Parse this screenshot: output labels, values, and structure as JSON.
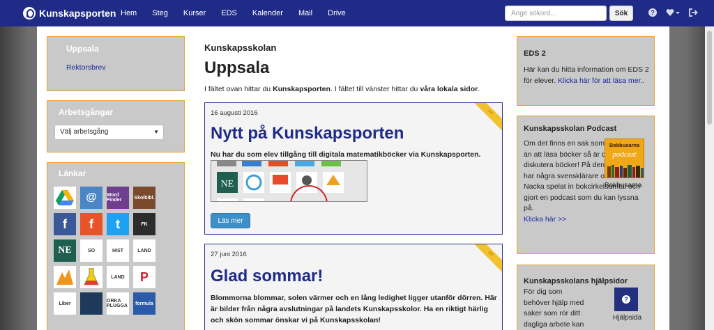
{
  "nav": {
    "brand": "Kunskapsporten",
    "links": [
      "Hem",
      "Steg",
      "Kurser",
      "EDS",
      "Kalender",
      "Mail",
      "Drive"
    ],
    "search_placeholder": "Ange sökord...",
    "search_button": "Sök",
    "icons": [
      "help-icon",
      "heart-dropdown-icon",
      "logout-icon"
    ]
  },
  "left": {
    "location_title": "Uppsala",
    "location_link": "Rektorsbrev",
    "pathways_title": "Arbetsgångar",
    "pathways_select": "Välj arbetsgång",
    "links_title": "Länkar",
    "tiles": [
      {
        "name": "google-drive-tile",
        "label": "",
        "bg": "#ffffff"
      },
      {
        "name": "mail-tile",
        "label": "@",
        "bg": "#4a86c5"
      },
      {
        "name": "wordfinder-tile",
        "label": "Word Finder",
        "bg": "#6f3f8e"
      },
      {
        "name": "skolbiblioteket-tile",
        "label": "Skolbibl.",
        "bg": "#7a4a2c"
      },
      {
        "name": "facebook-tile",
        "label": "f",
        "bg": "#3b5998"
      },
      {
        "name": "facebook-orange-tile",
        "label": "f",
        "bg": "#e8542a"
      },
      {
        "name": "twitter-tile",
        "label": "t",
        "bg": "#1da1f2"
      },
      {
        "name": "fk-tile",
        "label": "FK",
        "bg": "#2c2c2c"
      },
      {
        "name": "ne-tile",
        "label": "NE",
        "bg": "#1f5f4f"
      },
      {
        "name": "so-rummet-tile",
        "label": "SO",
        "bg": "#ffffff"
      },
      {
        "name": "historiska-bibliotek-tile",
        "label": "HIST",
        "bg": "#ffffff"
      },
      {
        "name": "landguiden-tile",
        "label": "LAND",
        "bg": "#ffffff"
      },
      {
        "name": "fox-tile",
        "label": "",
        "bg": "#ffffff"
      },
      {
        "name": "chemistry-tile",
        "label": "",
        "bg": "#ffffff"
      },
      {
        "name": "landguiden-2-tile",
        "label": "LAND",
        "bg": "#ffffff"
      },
      {
        "name": "pinterest-tile",
        "label": "P",
        "bg": "#ffffff"
      },
      {
        "name": "liber-tile",
        "label": "Liber",
        "bg": "#ffffff"
      },
      {
        "name": "dark-tile",
        "label": "",
        "bg": "#1e3a5a"
      },
      {
        "name": "orka-plugga-tile",
        "label": "ORKA PLUGGA",
        "bg": "#ffffff"
      },
      {
        "name": "formula-tile",
        "label": "formula",
        "bg": "#2a5aa8"
      }
    ]
  },
  "center": {
    "kicker": "Kunskapsskolan",
    "title": "Uppsala",
    "intro_1": "I fältet ovan hittar du ",
    "intro_bold_1": "Kunskapsporten",
    "intro_2": ". I fältet till vänster hittar du ",
    "intro_bold_2": "våra lokala sidor",
    "intro_3": ".",
    "articles": [
      {
        "date": "16 augusti 2016",
        "title": "Nytt på Kunskapsporten",
        "lead": "Nu har du som elev tillgång till digitala matematikböcker via Kunskapsporten.",
        "button": "Läs mer",
        "ribbon": "KP"
      },
      {
        "date": "27 juni 2016",
        "title": "Glad sommar!",
        "lead": "Blommorna blommar, solen värmer och en lång ledighet ligger utanför dörren. Här är bilder från några avslutningar på landets Kunskapsskolor. Ha en riktigt härlig och skön sommar önskar vi på Kunskapsskolan!",
        "ribbon": "KP"
      }
    ]
  },
  "right": {
    "eds": {
      "title": "EDS 2",
      "text": "Här kan du hitta information om EDS 2 för elever. ",
      "link": "Klicka här för att läsa mer.."
    },
    "podcast": {
      "title": "Kunskapsskolan Podcast",
      "text": "Om det finns en sak som är roligare än att läsa böcker så är det att diskutera böcker! På den här sidan har några svensklärare och elever i Nacka spelat in bokcirkelsamtal och gjort en podcast som du kan lyssna på. ",
      "link": "Klicka här >>",
      "image_top": "Bokbusarna",
      "image_word": "podcast",
      "caption": "Bokbusarna"
    },
    "help": {
      "title": "Kunskapsskolans hjälpsidor",
      "text": "För dig som behöver hjälp med saker som rör ditt dagliga arbete kan du klicka på",
      "caption": "Hjälpsida"
    }
  },
  "colors": {
    "navbar": "#1f2b86",
    "accent_border": "#e6a430",
    "link": "#1a2a9a",
    "button": "#3d8fc8"
  }
}
